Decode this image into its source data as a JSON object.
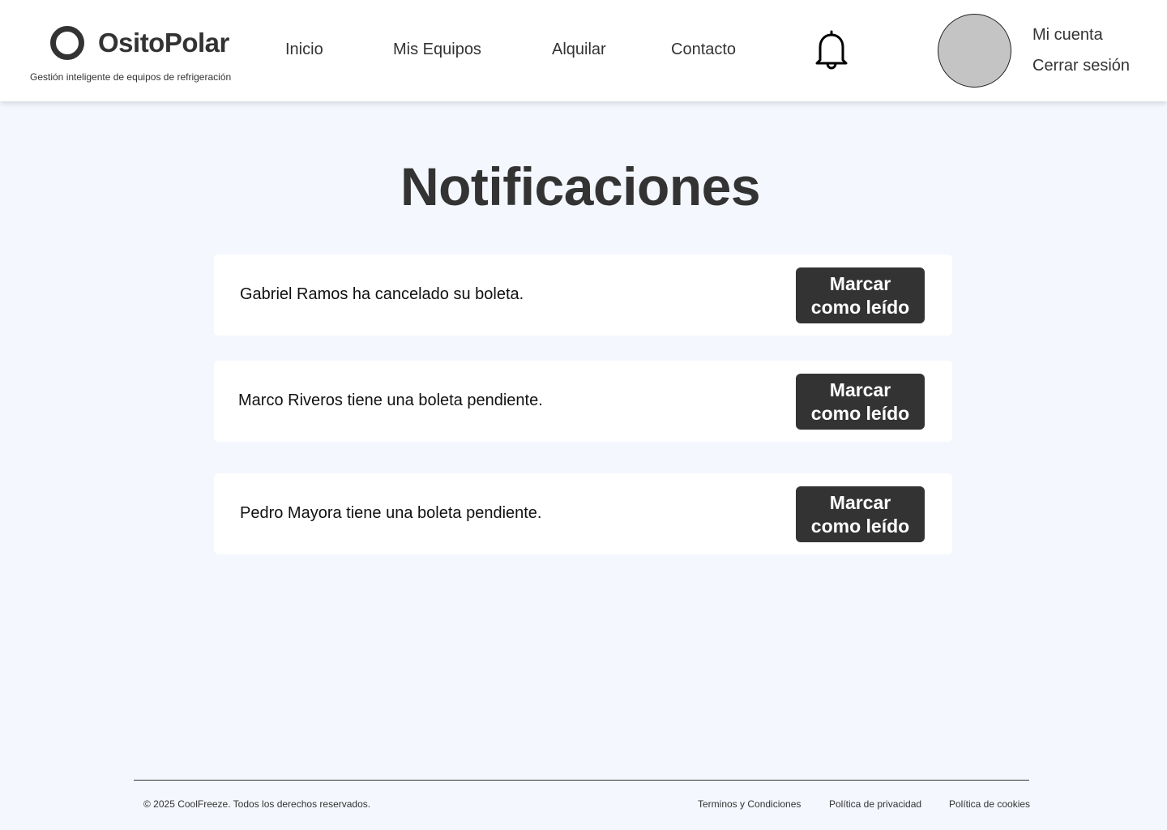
{
  "header": {
    "brand": "OsitoPolar",
    "tagline": "Gestión inteligente de equipos de refrigeración",
    "nav": [
      "Inicio",
      "Mis Equipos",
      "Alquilar",
      "Contacto"
    ],
    "account": {
      "my_account": "Mi cuenta",
      "logout": "Cerrar sesión"
    },
    "icons": {
      "logo": "ring-logo-icon",
      "notifications": "bell-icon"
    }
  },
  "main": {
    "title": "Notificaciones",
    "notifications": [
      {
        "message": "Gabriel Ramos ha cancelado su boleta.",
        "action": "Marcar como leído"
      },
      {
        "message": "Marco Riveros tiene una boleta pendiente.",
        "action": "Marcar como leído"
      },
      {
        "message": "Pedro Mayora tiene una boleta pendiente.",
        "action": "Marcar como leído"
      }
    ]
  },
  "footer": {
    "copyright": "© 2025 CoolFreeze. Todos los derechos reservados.",
    "links": [
      "Terminos y Condiciones",
      "Política de privacidad",
      "Política de cookies"
    ]
  },
  "colors": {
    "background": "#f4f7fd",
    "surface": "#ffffff",
    "primary_dark": "#333333",
    "avatar_placeholder": "#c4c4c4"
  }
}
